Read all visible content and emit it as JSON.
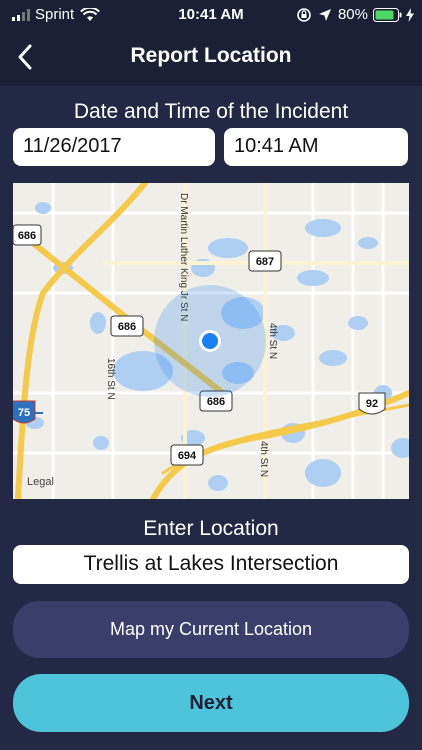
{
  "status_bar": {
    "carrier": "Sprint",
    "time": "10:41 AM",
    "battery": "80%"
  },
  "nav": {
    "title": "Report Location"
  },
  "incident": {
    "label": "Date and Time of the Incident",
    "date": "11/26/2017",
    "time": "10:41 AM"
  },
  "map": {
    "street_labels": [
      "Dr Martin Luther King Jr St N",
      "4th St N",
      "16th St N",
      "4th St N"
    ],
    "shields": [
      "686",
      "687",
      "686",
      "686",
      "694",
      "92",
      "75"
    ],
    "legal": "Legal",
    "colors": {
      "water": "#aecff2",
      "highway": "#f5c94a",
      "location": "#1a7ff0"
    }
  },
  "location": {
    "label": "Enter Location",
    "value": "Trellis at Lakes Intersection"
  },
  "buttons": {
    "current_location": "Map my Current Location",
    "next": "Next"
  }
}
